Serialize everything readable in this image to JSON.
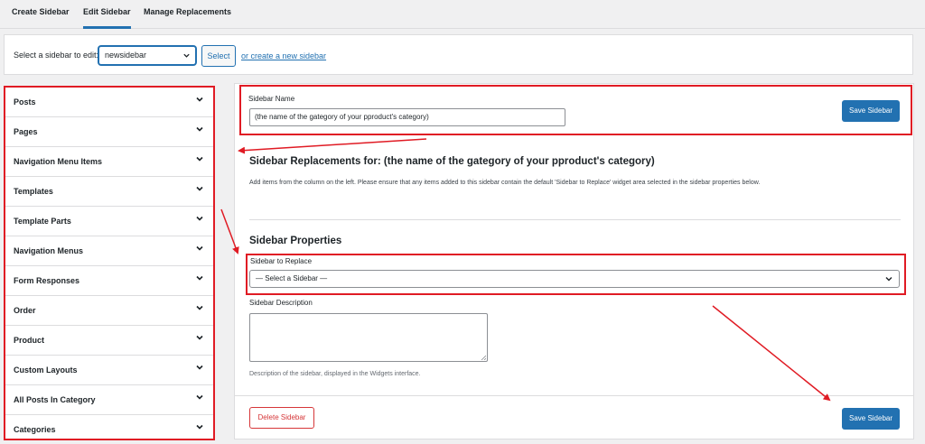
{
  "tabs": {
    "create": "Create Sidebar",
    "edit": "Edit Sidebar",
    "manage": "Manage Replacements"
  },
  "selector": {
    "label": "Select a sidebar to edit:",
    "selected": "newsidebar",
    "select_button": "Select",
    "create_link": "or create a new sidebar"
  },
  "accordion": {
    "items": [
      {
        "label": "Posts"
      },
      {
        "label": "Pages"
      },
      {
        "label": "Navigation Menu Items"
      },
      {
        "label": "Templates"
      },
      {
        "label": "Template Parts"
      },
      {
        "label": "Navigation Menus"
      },
      {
        "label": "Form Responses"
      },
      {
        "label": "Order"
      },
      {
        "label": "Product"
      },
      {
        "label": "Custom Layouts"
      },
      {
        "label": "All Posts In Category"
      },
      {
        "label": "Categories"
      }
    ]
  },
  "sidebar_name": {
    "label": "Sidebar Name",
    "value": "(the name of the gategory of your pproduct's category)",
    "save_label": "Save Sidebar"
  },
  "replacements": {
    "title": "Sidebar Replacements for: (the name of the gategory of your pproduct's category)",
    "description": "Add items from the column on the left. Please ensure that any items added to this sidebar contain the default 'Sidebar to Replace' widget area selected in the sidebar properties below."
  },
  "properties": {
    "title": "Sidebar Properties",
    "replace_label": "Sidebar to Replace",
    "replace_selected": "— Select a Sidebar —",
    "description_label": "Sidebar Description",
    "description_help": "Description of the sidebar, displayed in the Widgets interface."
  },
  "footer": {
    "delete_label": "Delete Sidebar",
    "save_label": "Save Sidebar"
  },
  "colors": {
    "accent": "#2271b1",
    "annotation": "#e01b24",
    "danger": "#d63638"
  },
  "icons": {
    "chevron": "chevron-down-icon"
  }
}
